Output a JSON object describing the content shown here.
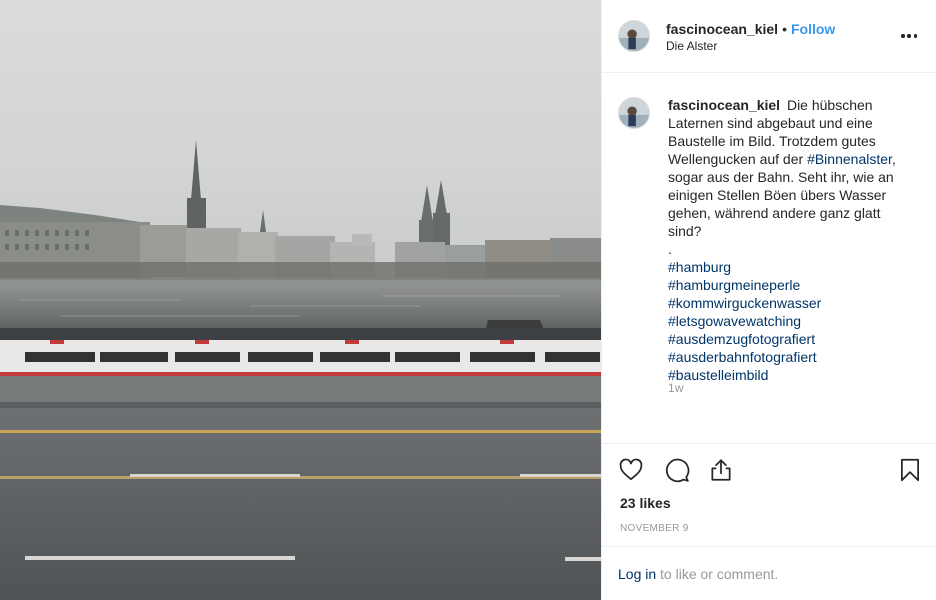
{
  "post": {
    "username": "fascinocean_kiel",
    "separator": "•",
    "follow_label": "Follow",
    "location": "Die Alster",
    "more_icon": "more-options-icon"
  },
  "caption": {
    "text_part1": "Die hübschen Laternen sind abgebaut und eine Baustelle im Bild. Trotzdem gutes Wellengucken auf der ",
    "hashtag_inline": "#Binnenalster",
    "text_part2": ", sogar aus der Bahn. Seht ihr, wie an einigen Stellen Böen übers Wasser gehen, während andere ganz glatt sind?",
    "period_line": ".",
    "hashtags_line1_a": "#hamburg",
    "hashtags_line1_b": "#hamburgmeineperle",
    "hashtags": [
      "#kommwirguckenwasser",
      "#letsgowavewatching",
      "#ausdemzugfotografiert",
      "#ausderbahnfotografiert",
      "#baustelleimbild"
    ],
    "relative_time": "1w"
  },
  "actions": {
    "like_icon": "heart-icon",
    "comment_icon": "comment-icon",
    "share_icon": "share-icon",
    "save_icon": "bookmark-icon",
    "likes_text": "23 likes",
    "date": "NOVEMBER 9"
  },
  "comment_bar": {
    "login_link": "Log in",
    "login_suffix": " to like or comment."
  },
  "colors": {
    "follow": "#3897f0",
    "hashtag": "#003569",
    "muted": "#999999",
    "text": "#262626",
    "border": "#efefef"
  },
  "photo": {
    "description_icon": "post-photo"
  }
}
